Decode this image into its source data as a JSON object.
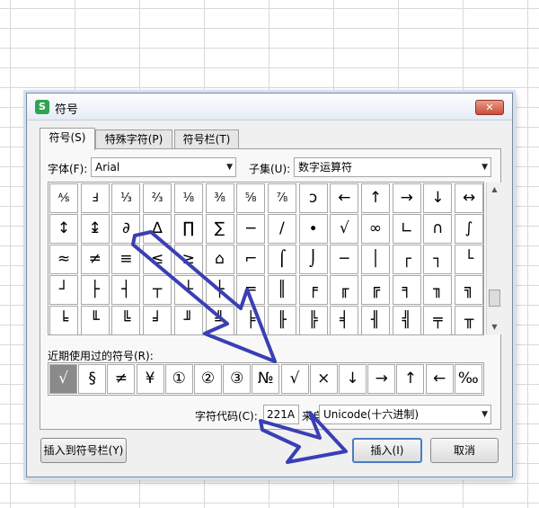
{
  "dialog": {
    "app_icon_letter": "S",
    "title": "符号",
    "close_label": "✕",
    "tabs": [
      {
        "label": "符号(S)"
      },
      {
        "label": "特殊字符(P)"
      },
      {
        "label": "符号栏(T)"
      }
    ],
    "font_label": "字体(F):",
    "font_value": "Arial",
    "subset_label": "子集(U):",
    "subset_value": "数字运算符",
    "symbols": [
      "⅍",
      "Ⅎ",
      "⅓",
      "⅔",
      "⅛",
      "⅜",
      "⅝",
      "⅞",
      "ↄ",
      "←",
      "↑",
      "→",
      "↓",
      "↔",
      "↕",
      "↨",
      "∂",
      "∆",
      "∏",
      "∑",
      "−",
      "∕",
      "∙",
      "√",
      "∞",
      "∟",
      "∩",
      "∫",
      "≈",
      "≠",
      "≡",
      "≤",
      "≥",
      "⌂",
      "⌐",
      "⌠",
      "⌡",
      "─",
      "│",
      "┌",
      "┐",
      "└",
      "┘",
      "├",
      "┤",
      "┬",
      "┴",
      "┼",
      "═",
      "║",
      "╒",
      "╓",
      "╔",
      "╕",
      "╖",
      "╗",
      "╘",
      "╙",
      "╚",
      "╛",
      "╜",
      "╝",
      "╞",
      "╟",
      "╠",
      "╡",
      "╢",
      "╣",
      "╤",
      "╥"
    ],
    "recent_label": "近期使用过的符号(R):",
    "recent_symbols": [
      "√",
      "§",
      "≠",
      "¥",
      "①",
      "②",
      "③",
      "№",
      "√",
      "×",
      "↓",
      "→",
      "↑",
      "←",
      "‰"
    ],
    "code_label": "字符代码(C):",
    "code_value": "221A",
    "from_label": "来自(M)",
    "from_value": "Unicode(十六进制)",
    "btn_insert_to_bar": "插入到符号栏(Y)",
    "btn_insert": "插入(I)",
    "btn_cancel": "取消"
  },
  "colors": {
    "annotation_arrow": "#3a3fb4",
    "selected_cell": "#8a8a8a",
    "app_icon": "#2fa44f"
  }
}
